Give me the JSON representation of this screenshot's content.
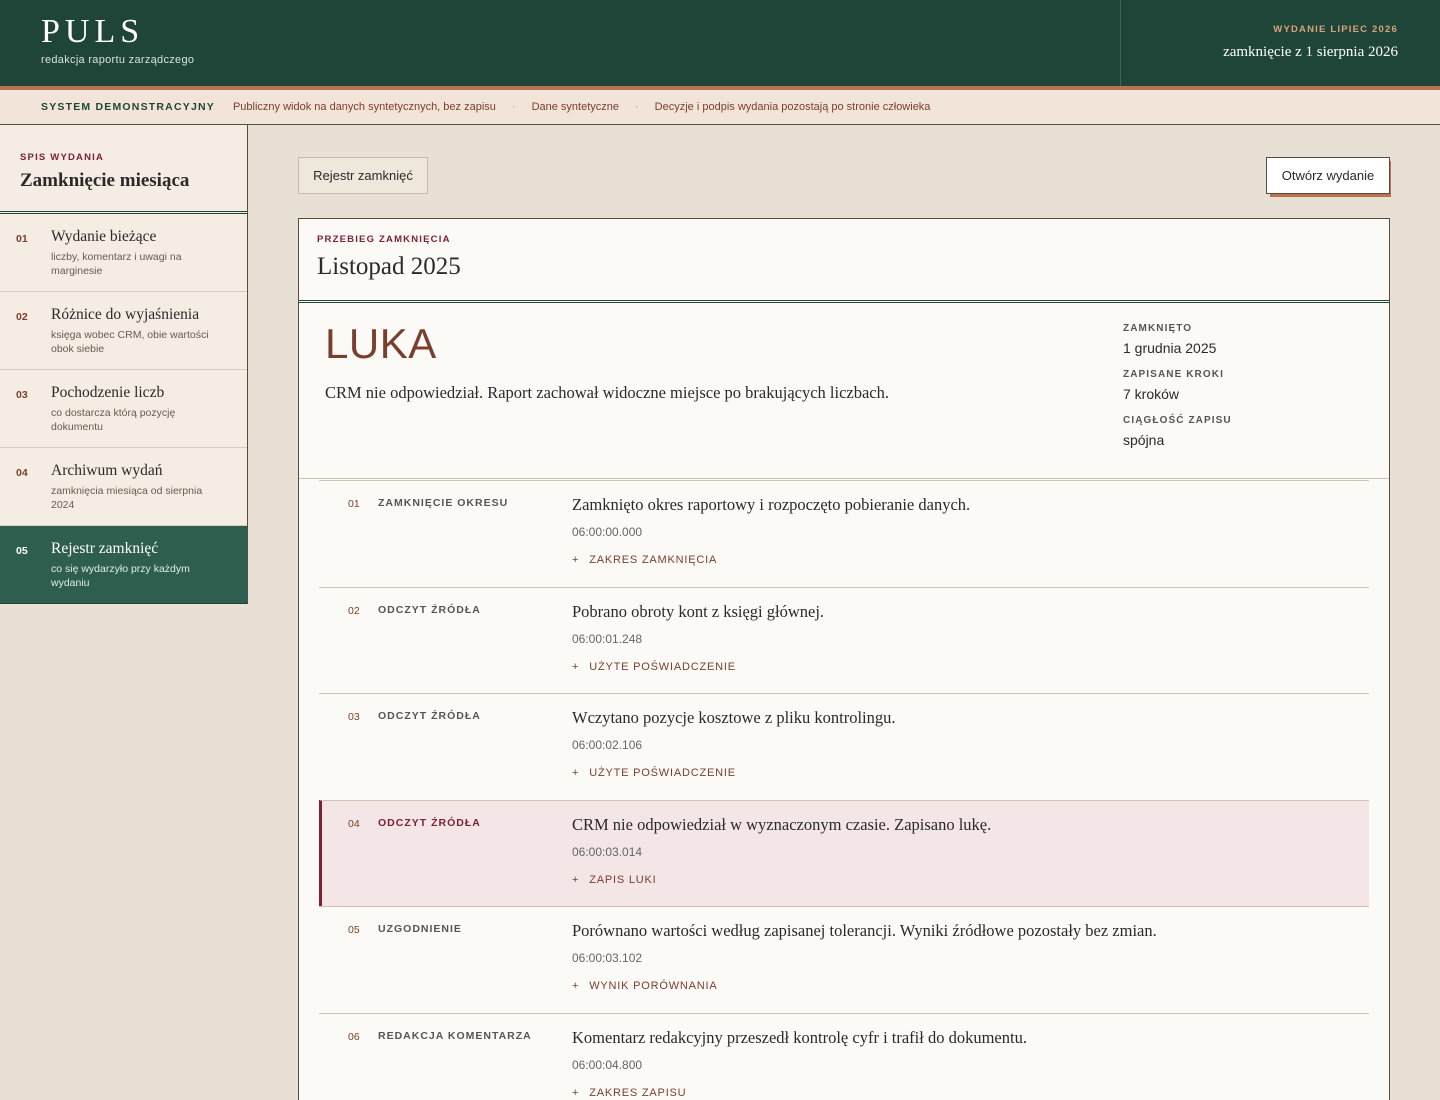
{
  "header": {
    "brand": "PULS",
    "brand_sub": "redakcja raportu zarządczego",
    "edition_kicker": "WYDANIE LIPIEC 2026",
    "edition_close": "zamknięcie z 1 sierpnia 2026"
  },
  "notice": {
    "label": "SYSTEM DEMONSTRACYJNY",
    "items": [
      "Publiczny widok na danych syntetycznych, bez zapisu",
      "Dane syntetyczne",
      "Decyzje i podpis wydania pozostają po stronie człowieka"
    ],
    "separator": "·"
  },
  "sidebar": {
    "kicker": "SPIS WYDANIA",
    "title": "Zamknięcie miesiąca",
    "items": [
      {
        "num": "01",
        "title": "Wydanie bieżące",
        "desc": "liczby, komentarz i uwagi na marginesie"
      },
      {
        "num": "02",
        "title": "Różnice do wyjaśnienia",
        "desc": "księga wobec CRM, obie wartości obok siebie"
      },
      {
        "num": "03",
        "title": "Pochodzenie liczb",
        "desc": "co dostarcza którą pozycję dokumentu"
      },
      {
        "num": "04",
        "title": "Archiwum wydań",
        "desc": "zamknięcia miesiąca od sierpnia 2024"
      },
      {
        "num": "05",
        "title": "Rejestr zamknięć",
        "desc": "co się wydarzyło przy każdym wydaniu"
      }
    ]
  },
  "toolbar": {
    "register_label": "Rejestr zamknięć",
    "open_label": "Otwórz wydanie"
  },
  "panel": {
    "kicker": "PRZEBIEG ZAMKNIĘCIA",
    "title": "Listopad 2025",
    "status_word": "LUKA",
    "status_text": "CRM nie odpowiedział. Raport zachował widoczne miejsce po brakujących liczbach.",
    "meta": [
      {
        "label": "ZAMKNIĘTO",
        "value": "1 grudnia 2025"
      },
      {
        "label": "ZAPISANE KROKI",
        "value": "7 kroków"
      },
      {
        "label": "CIĄGŁOŚĆ ZAPISU",
        "value": "spójna"
      }
    ],
    "steps": [
      {
        "num": "01",
        "type": "ZAMKNIĘCIE OKRESU",
        "text": "Zamknięto okres raportowy i rozpoczęto pobieranie danych.",
        "time": "06:00:00.000",
        "link": "ZAKRES ZAMKNIĘCIA"
      },
      {
        "num": "02",
        "type": "ODCZYT ŹRÓDŁA",
        "text": "Pobrano obroty kont z księgi głównej.",
        "time": "06:00:01.248",
        "link": "UŻYTE POŚWIADCZENIE"
      },
      {
        "num": "03",
        "type": "ODCZYT ŹRÓDŁA",
        "text": "Wczytano pozycje kosztowe z pliku kontrolingu.",
        "time": "06:00:02.106",
        "link": "UŻYTE POŚWIADCZENIE"
      },
      {
        "num": "04",
        "type": "ODCZYT ŹRÓDŁA",
        "text": "CRM nie odpowiedział w wyznaczonym czasie. Zapisano lukę.",
        "time": "06:00:03.014",
        "link": "ZAPIS LUKI"
      },
      {
        "num": "05",
        "type": "UZGODNIENIE",
        "text": "Porównano wartości według zapisanej tolerancji. Wyniki źródłowe pozostały bez zmian.",
        "time": "06:00:03.102",
        "link": "WYNIK PORÓWNANIA"
      },
      {
        "num": "06",
        "type": "REDAKCJA KOMENTARZA",
        "text": "Komentarz redakcyjny przeszedł kontrolę cyfr i trafił do dokumentu.",
        "time": "06:00:04.800",
        "link": "ZAKRES ZAPISU"
      }
    ],
    "link_prefix": "+"
  },
  "colors": {
    "header_bg": "#1f4538",
    "accent": "#b87350",
    "alert": "#7a2236",
    "active_nav": "#2e5e4d"
  }
}
